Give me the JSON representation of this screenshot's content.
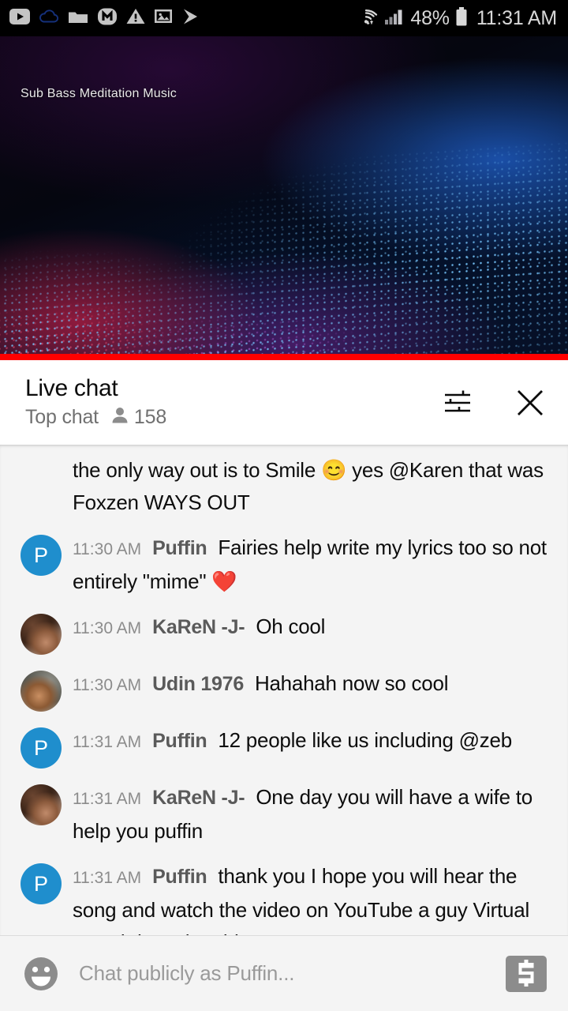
{
  "status_bar": {
    "battery_percent": "48%",
    "time": "11:31 AM",
    "left_icons": [
      "youtube-icon",
      "cloud-icon",
      "folder-icon",
      "m-app-icon",
      "warning-icon",
      "photos-icon",
      "play-store-icon"
    ],
    "right_icons": [
      "wifi-icon",
      "cell-signal-icon",
      "battery-icon"
    ]
  },
  "video": {
    "title": "Sub Bass Meditation Music",
    "progress_percent": 100,
    "progress_color": "#ff0000"
  },
  "chat_header": {
    "title": "Live chat",
    "mode": "Top chat",
    "viewer_count": "158",
    "filter_icon": "tune-icon",
    "close_icon": "close-icon"
  },
  "messages": [
    {
      "avatar_type": "none",
      "time": "",
      "author": "",
      "text": "the only way out is to Smile 😊 yes @Karen that was Foxzen WAYS OUT",
      "clipped": true
    },
    {
      "avatar_type": "letter",
      "avatar_letter": "P",
      "avatar_color": "#1f8ecd",
      "time": "11:30 AM",
      "author": "Puffin",
      "text": "Fairies help write my lyrics too so not entirely \"mime\" ❤️"
    },
    {
      "avatar_type": "photo-a",
      "time": "11:30 AM",
      "author": "KaReN -J-",
      "text": "Oh cool"
    },
    {
      "avatar_type": "photo-b",
      "time": "11:30 AM",
      "author": "Udin 1976",
      "text": "Hahahah now so cool"
    },
    {
      "avatar_type": "letter",
      "avatar_letter": "P",
      "avatar_color": "#1f8ecd",
      "time": "11:31 AM",
      "author": "Puffin",
      "text": "12 people like us including @zeb"
    },
    {
      "avatar_type": "photo-a",
      "time": "11:31 AM",
      "author": "KaReN -J-",
      "text": "One day you will have a wife to help you puffin"
    },
    {
      "avatar_type": "letter",
      "avatar_letter": "P",
      "avatar_color": "#1f8ecd",
      "time": "11:31 AM",
      "author": "Puffin",
      "text": "thank you I hope you will hear the song and watch the video on YouTube a guy Virtual Portal does the videos"
    }
  ],
  "composer": {
    "placeholder": "Chat publicly as Puffin...",
    "emoji_icon": "emoji-smiley-icon",
    "superchat_icon": "dollar-superchat-icon"
  }
}
